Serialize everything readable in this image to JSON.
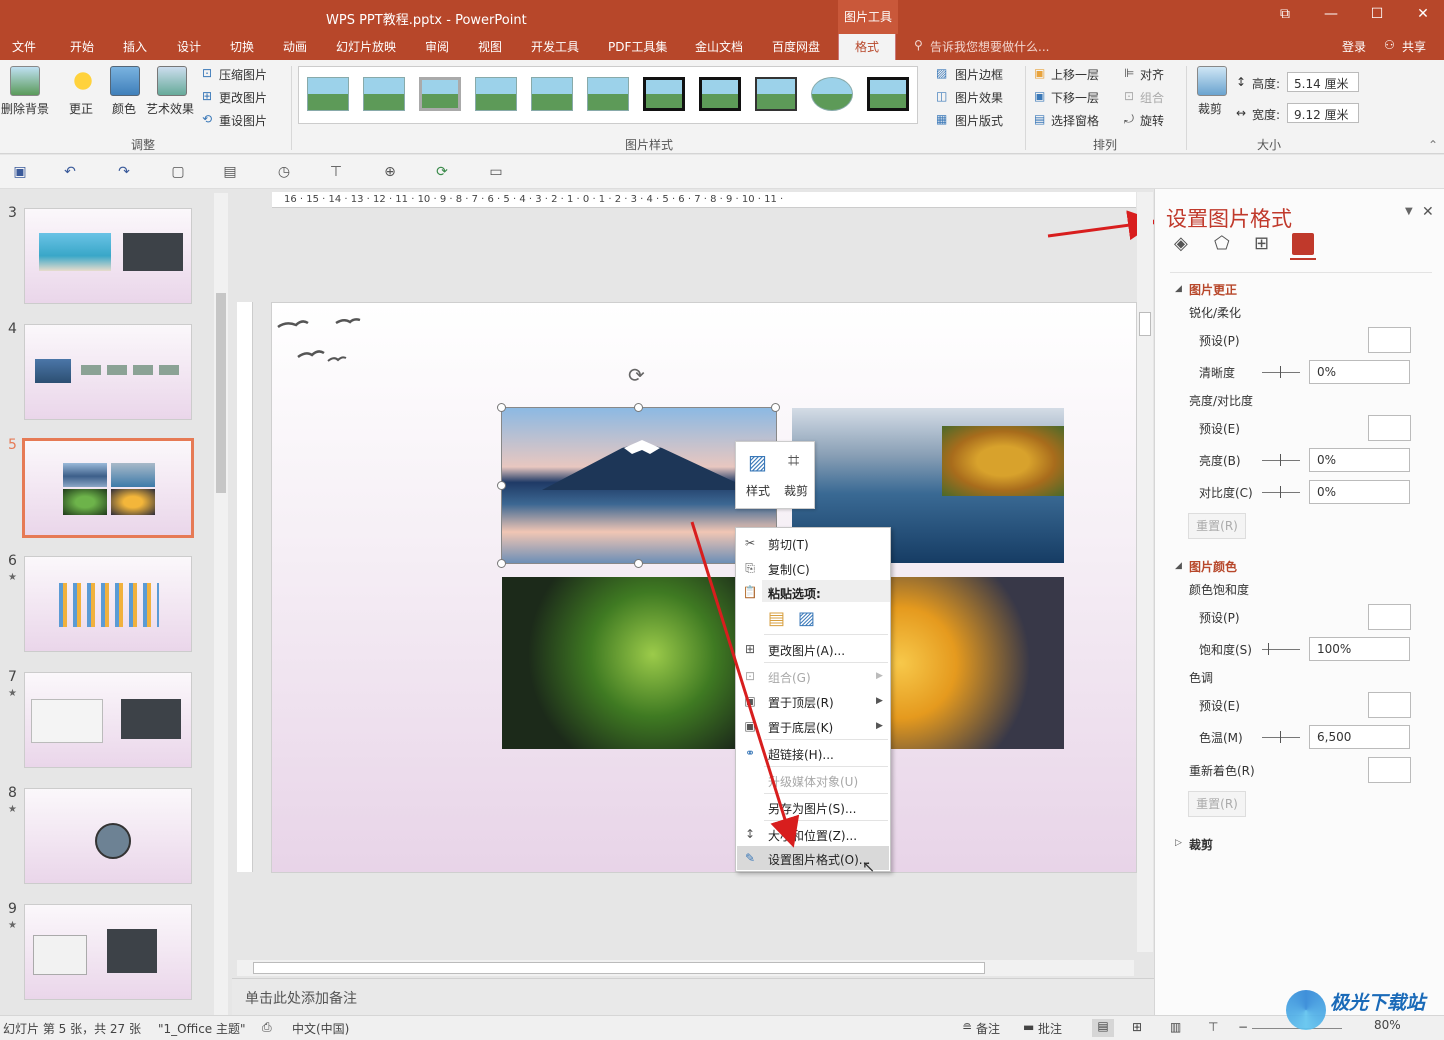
{
  "titlebar": {
    "title": "WPS PPT教程.pptx - PowerPoint",
    "context_tab": "图片工具"
  },
  "tabs": [
    "文件",
    "开始",
    "插入",
    "设计",
    "切换",
    "动画",
    "幻灯片放映",
    "审阅",
    "视图",
    "开发工具",
    "PDF工具集",
    "金山文档",
    "百度网盘",
    "格式"
  ],
  "tell_me": "告诉我您想要做什么...",
  "account": {
    "login": "登录",
    "share": "共享"
  },
  "ribbon": {
    "adjust": {
      "remove_bg": "删除背景",
      "corrections": "更正",
      "color": "颜色",
      "artistic": "艺术效果",
      "compress": "压缩图片",
      "change": "更改图片",
      "reset": "重设图片",
      "group": "调整"
    },
    "styles": {
      "border": "图片边框",
      "effects": "图片效果",
      "layout": "图片版式",
      "group": "图片样式"
    },
    "arrange": {
      "forward": "上移一层",
      "backward": "下移一层",
      "pane": "选择窗格",
      "align": "对齐",
      "group_btn": "组合",
      "rotate": "旋转",
      "group": "排列"
    },
    "size": {
      "crop": "裁剪",
      "height_label": "高度:",
      "height": "5.14 厘米",
      "width_label": "宽度:",
      "width": "9.12 厘米",
      "group": "大小"
    }
  },
  "slides": [
    {
      "num": "3",
      "star": ""
    },
    {
      "num": "4",
      "star": ""
    },
    {
      "num": "5",
      "star": ""
    },
    {
      "num": "6",
      "star": "★"
    },
    {
      "num": "7",
      "star": "★"
    },
    {
      "num": "8",
      "star": "★"
    },
    {
      "num": "9",
      "star": "★"
    }
  ],
  "ruler": "16 · 15 · 14 · 13 · 12 · 11 · 10 · 9 · 8 · 7 · 6 · 5 · 4 · 3 · 2 · 1 · 0 · 1 · 2 · 3 · 4 · 5 · 6 · 7 · 8 · 9 · 10 · 11 ·",
  "mini_toolbar": {
    "style": "样式",
    "crop": "裁剪"
  },
  "context_menu": {
    "cut": "剪切(T)",
    "copy": "复制(C)",
    "paste_options": "粘贴选项:",
    "change_picture": "更改图片(A)...",
    "group": "组合(G)",
    "bring_front": "置于顶层(R)",
    "send_back": "置于底层(K)",
    "hyperlink": "超链接(H)...",
    "upgrade_media": "升级媒体对象(U)",
    "save_as": "另存为图片(S)...",
    "size_position": "大小和位置(Z)...",
    "format_picture": "设置图片格式(O)..."
  },
  "pane": {
    "title": "设置图片格式",
    "corrections": {
      "header": "图片更正",
      "sharpen": "锐化/柔化",
      "preset": "预设(P)",
      "sharpness": "清晰度",
      "sharpness_val": "0%",
      "bc": "亮度/对比度",
      "preset2": "预设(E)",
      "brightness": "亮度(B)",
      "brightness_val": "0%",
      "contrast": "对比度(C)",
      "contrast_val": "0%",
      "reset": "重置(R)"
    },
    "color": {
      "header": "图片颜色",
      "saturation_head": "颜色饱和度",
      "preset": "预设(P)",
      "saturation": "饱和度(S)",
      "saturation_val": "100%",
      "tone": "色调",
      "preset2": "预设(E)",
      "temperature": "色温(M)",
      "temperature_val": "6,500",
      "recolor": "重新着色(R)",
      "reset": "重置(R)"
    },
    "crop": "裁剪"
  },
  "notes": "单击此处添加备注",
  "status": {
    "slide": "幻灯片 第 5 张，共 27 张",
    "theme": "\"1_Office 主题\"",
    "lang": "中文(中国)",
    "notes": "备注",
    "comments": "批注",
    "zoom": "80%"
  },
  "watermark": "极光下载站"
}
